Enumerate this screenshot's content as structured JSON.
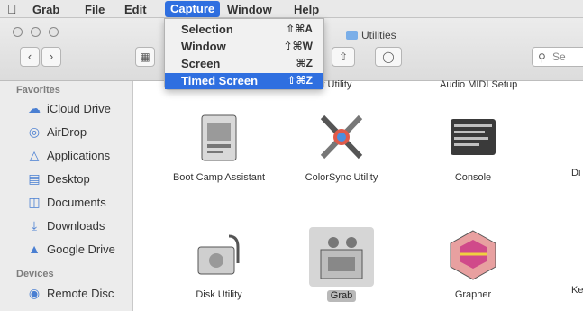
{
  "menubar": {
    "apple": "",
    "items": [
      "Grab",
      "File",
      "Edit",
      "Capture",
      "Window",
      "Help"
    ],
    "active_index": 3
  },
  "capture_menu": {
    "items": [
      {
        "label": "Selection",
        "shortcut": "⇧⌘A"
      },
      {
        "label": "Window",
        "shortcut": "⇧⌘W"
      },
      {
        "label": "Screen",
        "shortcut": "⌘Z"
      },
      {
        "label": "Timed Screen",
        "shortcut": "⇧⌘Z"
      }
    ],
    "highlighted_index": 3
  },
  "window": {
    "title": "Utilities",
    "search_placeholder": "Se"
  },
  "sidebar": {
    "favorites_header": "Favorites",
    "favorites": [
      {
        "label": "iCloud Drive",
        "icon": "cloud-icon"
      },
      {
        "label": "AirDrop",
        "icon": "airdrop-icon"
      },
      {
        "label": "Applications",
        "icon": "applications-icon"
      },
      {
        "label": "Desktop",
        "icon": "desktop-icon"
      },
      {
        "label": "Documents",
        "icon": "documents-icon"
      },
      {
        "label": "Downloads",
        "icon": "downloads-icon"
      },
      {
        "label": "Google Drive",
        "icon": "google-drive-icon"
      }
    ],
    "devices_header": "Devices",
    "devices": [
      {
        "label": "Remote Disc",
        "icon": "disc-icon"
      }
    ]
  },
  "content": {
    "partial_top": [
      "...ery Utility",
      "Audio MIDI Setup"
    ],
    "row1": [
      {
        "label": "Boot Camp Assistant",
        "icon": "boot-camp-icon"
      },
      {
        "label": "ColorSync Utility",
        "icon": "colorsync-icon"
      },
      {
        "label": "Console",
        "icon": "console-icon"
      },
      {
        "label": "Di",
        "icon": "partial-icon"
      }
    ],
    "row2": [
      {
        "label": "Disk Utility",
        "icon": "disk-utility-icon"
      },
      {
        "label": "Grab",
        "icon": "grab-icon",
        "selected": true
      },
      {
        "label": "Grapher",
        "icon": "grapher-icon"
      },
      {
        "label": "Ke",
        "icon": "partial-icon"
      }
    ]
  }
}
